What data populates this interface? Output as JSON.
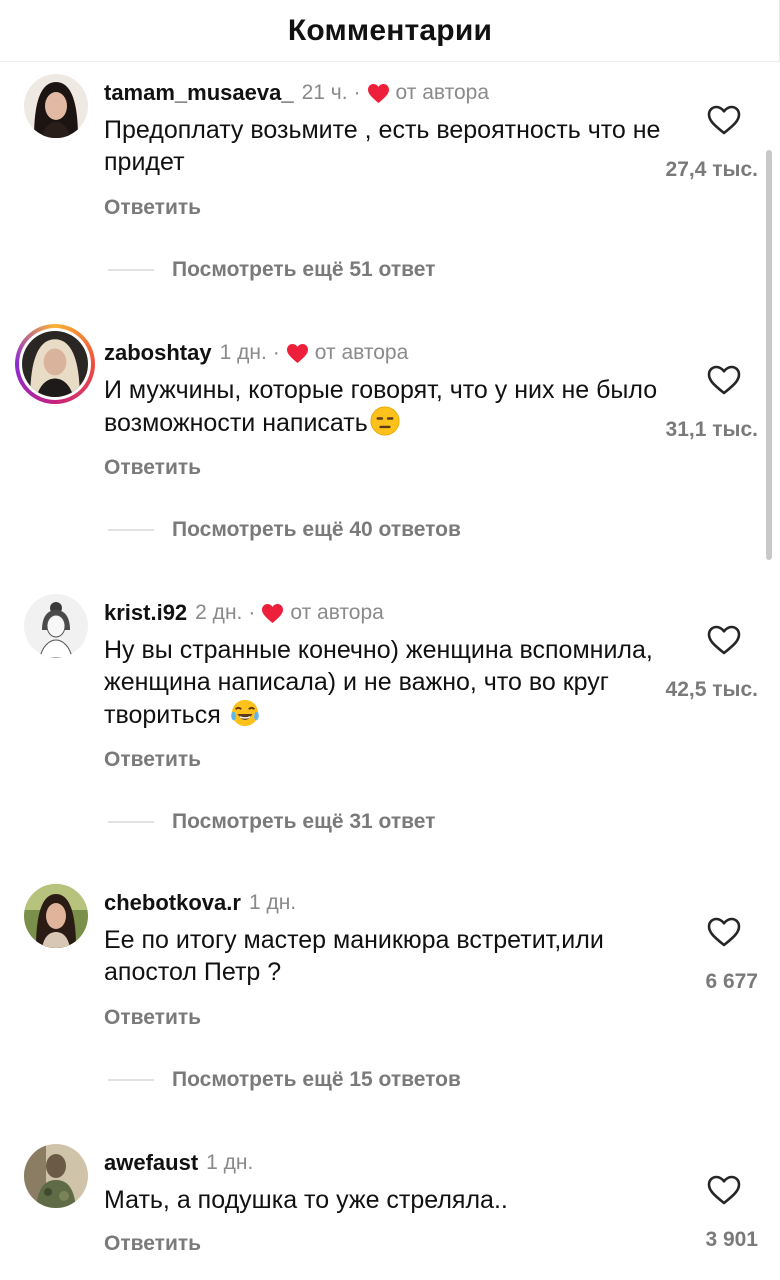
{
  "header": {
    "title": "Комментарии"
  },
  "comments": [
    {
      "username": "tamam_musaeva_",
      "time": "21 ч.",
      "separator": "·",
      "author_label": "от автора",
      "text": "Предоплату возьмите , есть вероятность что не придет",
      "reply_label": "Ответить",
      "likes": "27,4 тыс.",
      "more_replies": "Посмотреть ещё 51 ответ",
      "avatar_icon": "avatar-woman-dark-hair"
    },
    {
      "username": "zaboshtay",
      "time": "1 дн.",
      "separator": "·",
      "author_label": "от автора",
      "text": "И мужчины, которые говорят, что у них не было возможности написать",
      "emoji": "expressionless-face",
      "reply_label": "Ответить",
      "likes": "31,1 тыс.",
      "more_replies": "Посмотреть ещё 40 ответов",
      "avatar_icon": "avatar-woman-blonde-story-ring"
    },
    {
      "username": "krist.i92",
      "time": "2 дн.",
      "separator": "·",
      "author_label": "от автора",
      "text": "Ну вы странные конечно) женщина вспомнила, женщина написала) и не важно, что во круг твориться",
      "emoji": "tears-of-joy-face",
      "reply_label": "Ответить",
      "likes": "42,5 тыс.",
      "more_replies": "Посмотреть ещё 31 ответ",
      "avatar_icon": "avatar-woman-sketch"
    },
    {
      "username": "chebotkova.r",
      "time": "1 дн.",
      "text": "Ее по итогу мастер маникюра встретит,или апостол Петр ?",
      "reply_label": "Ответить",
      "likes": "6 677",
      "more_replies": "Посмотреть ещё 15 ответов",
      "avatar_icon": "avatar-woman-green-background"
    },
    {
      "username": "awefaust",
      "time": "1 дн.",
      "text": "Мать, а подушка то уже стреляла..",
      "reply_label": "Ответить",
      "likes": "3 901",
      "avatar_icon": "avatar-man-camouflage"
    }
  ],
  "colors": {
    "heart_red": "#ed1f3a",
    "muted_text": "#7a7a7a",
    "time_text": "#8a8a8a"
  }
}
